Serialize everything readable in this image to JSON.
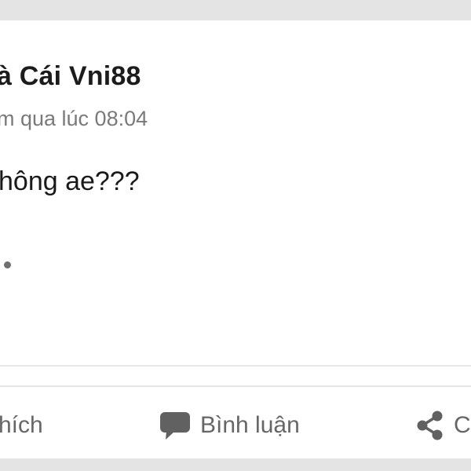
{
  "post": {
    "author": "à Cái Vni88",
    "timestamp": "m qua lúc 08:04",
    "text": "hông ae???"
  },
  "actions": {
    "like": {
      "label": "hích",
      "icon": "like-icon"
    },
    "comment": {
      "label": "Bình luận",
      "icon": "comment-bubble-icon"
    },
    "share": {
      "label": "C",
      "icon": "share-icon"
    }
  },
  "colors": {
    "background": "#e4e4e4",
    "card": "#ffffff",
    "text_primary": "#1c1c1c",
    "text_secondary": "#7a7a7a",
    "action_text": "#666666"
  }
}
